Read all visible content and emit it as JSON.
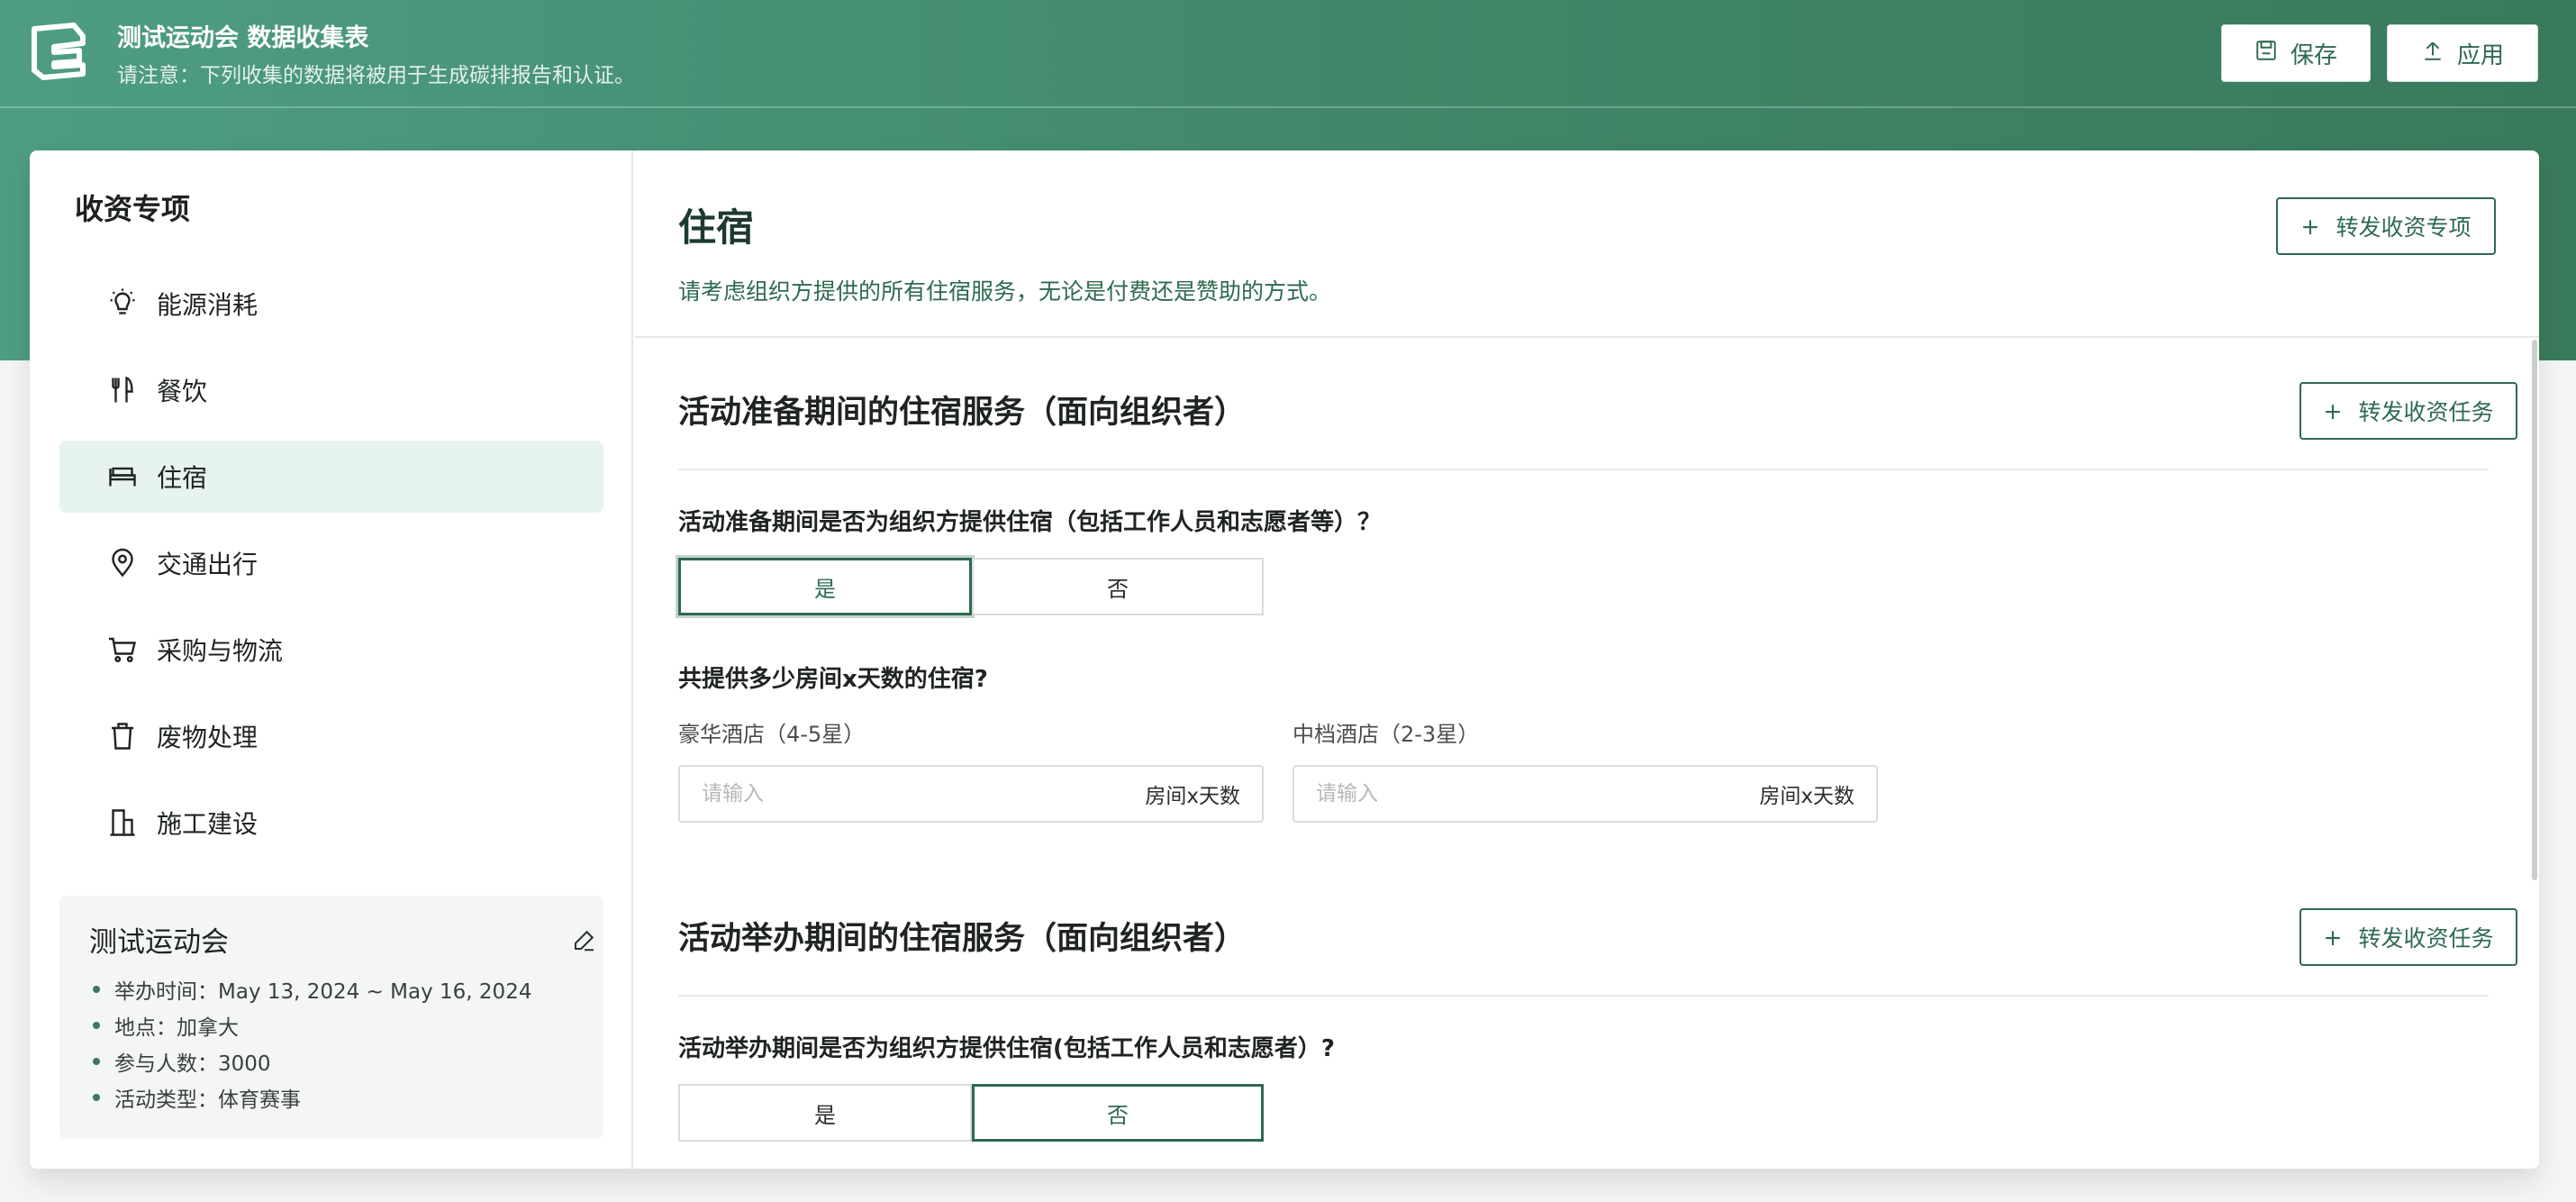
{
  "header": {
    "title": "测试运动会 数据收集表",
    "subtitle": "请注意：下列收集的数据将被用于生成碳排报告和认证。",
    "save_label": "保存",
    "apply_label": "应用"
  },
  "sidebar": {
    "title": "收资专项",
    "items": [
      {
        "label": "能源消耗",
        "icon": "lightbulb-icon"
      },
      {
        "label": "餐饮",
        "icon": "utensils-icon"
      },
      {
        "label": "住宿",
        "icon": "bed-icon",
        "active": true
      },
      {
        "label": "交通出行",
        "icon": "location-pin-icon"
      },
      {
        "label": "采购与物流",
        "icon": "cart-icon"
      },
      {
        "label": "废物处理",
        "icon": "trash-icon"
      },
      {
        "label": "施工建设",
        "icon": "building-icon"
      }
    ],
    "event": {
      "name": "测试运动会",
      "details": [
        "举办时间：May 13, 2024 ~ May 16, 2024",
        "地点：加拿大",
        "参与人数：3000",
        "活动类型：体育赛事"
      ]
    }
  },
  "main": {
    "title": "住宿",
    "description": "请考虑组织方提供的所有住宿服务，无论是付费还是赞助的方式。",
    "forward_item_label": "转发收资专项",
    "plus": "+",
    "sections": [
      {
        "title": "活动准备期间的住宿服务（面向组织者）",
        "forward_task_label": "转发收资任务",
        "question": "活动准备期间是否为组织方提供住宿（包括工作人员和志愿者等）？",
        "yes": "是",
        "no": "否",
        "selected": "yes",
        "subquestion": "共提供多少房间x天数的住宿?",
        "fields": [
          {
            "label": "豪华酒店（4-5星）",
            "placeholder": "请输入",
            "value": "",
            "unit": "房间x天数"
          },
          {
            "label": "中档酒店（2-3星）",
            "placeholder": "请输入",
            "value": "",
            "unit": "房间x天数"
          }
        ]
      },
      {
        "title": "活动举办期间的住宿服务（面向组织者）",
        "forward_task_label": "转发收资任务",
        "question": "活动举办期间是否为组织方提供住宿(包括工作人员和志愿者）?",
        "yes": "是",
        "no": "否",
        "selected": "no"
      }
    ]
  },
  "colors": {
    "brand": "#3f8566",
    "accent_text": "#2d6a50",
    "active_nav_bg": "#e6f3ee"
  }
}
